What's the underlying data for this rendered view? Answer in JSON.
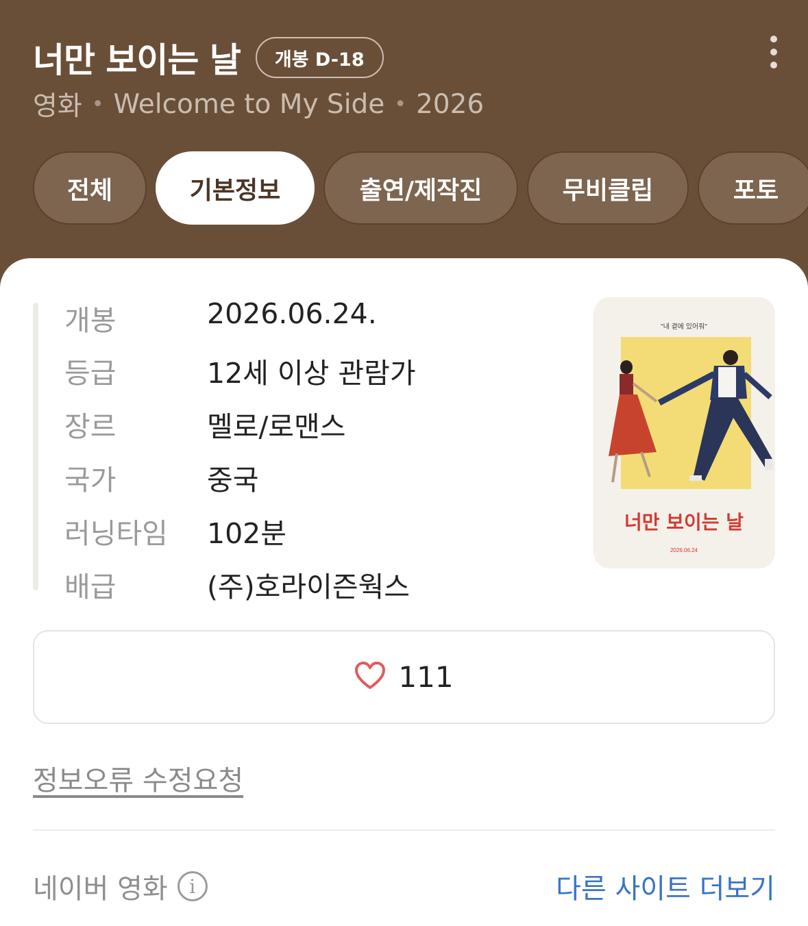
{
  "header": {
    "title": "너만 보이는 날",
    "badge": "개봉 D-18",
    "subtitle": {
      "type": "영화",
      "english_title": "Welcome to My Side",
      "year": "2026"
    }
  },
  "tabs": [
    {
      "label": "전체",
      "active": false
    },
    {
      "label": "기본정보",
      "active": true
    },
    {
      "label": "출연/제작진",
      "active": false
    },
    {
      "label": "무비클립",
      "active": false
    },
    {
      "label": "포토",
      "active": false
    }
  ],
  "info": [
    {
      "label": "개봉",
      "value": "2026.06.24."
    },
    {
      "label": "등급",
      "value": "12세 이상 관람가"
    },
    {
      "label": "장르",
      "value": "멜로/로맨스"
    },
    {
      "label": "국가",
      "value": "중국"
    },
    {
      "label": "러닝타임",
      "value": "102분"
    },
    {
      "label": "배급",
      "value": "(주)호라이즌웍스"
    }
  ],
  "poster": {
    "tagline": "\"내 곁에 있어줘\"",
    "title": "너만 보이는 날",
    "date": "2026.06.24"
  },
  "like": {
    "count": "111",
    "icon": "heart-icon"
  },
  "report_link": "정보오류 수정요청",
  "footer": {
    "source": "네이버 영화",
    "more_sites": "다른 사이트 더보기"
  },
  "colors": {
    "header_bg": "#6a4f38",
    "accent_link": "#3a73c8",
    "heart": "#e25b5b"
  }
}
